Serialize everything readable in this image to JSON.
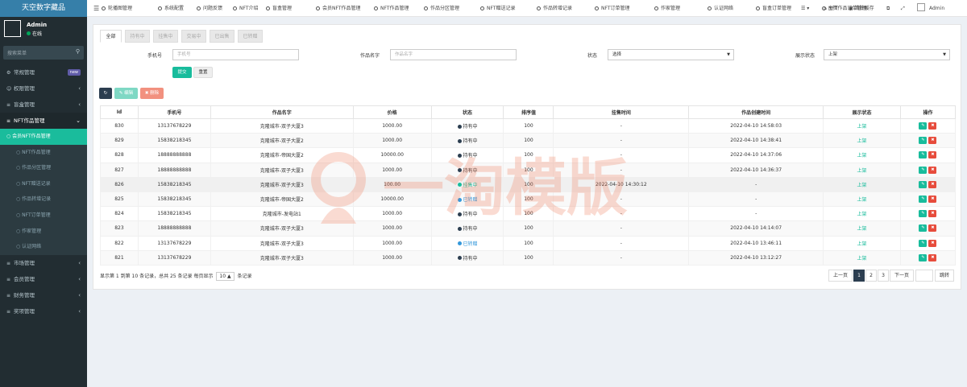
{
  "brand": "天空数字藏品",
  "user": {
    "name": "Admin",
    "status": "在线"
  },
  "sidebar": {
    "search_placeholder": "搜索菜单",
    "new_badge": "new",
    "items_top": [
      {
        "label": "常规管理",
        "icon": "gear-icon",
        "badge": "new"
      },
      {
        "label": "权限管理",
        "icon": "group-icon"
      },
      {
        "label": "盲盒管理",
        "icon": "list-icon"
      }
    ],
    "group": {
      "label": "NFT作品管理",
      "icon": "list-icon"
    },
    "sub_items": [
      "会员NFT作品管理",
      "NFT作品管理",
      "作品分区管理",
      "NFT赠送记录",
      "作品转增记录",
      "NFT订单管理",
      "作家管理",
      "认证网络"
    ],
    "items_bottom": [
      {
        "label": "市场管理",
        "icon": "list-icon"
      },
      {
        "label": "会员管理",
        "icon": "list-icon"
      },
      {
        "label": "财务管理",
        "icon": "list-icon"
      },
      {
        "label": "奖项管理",
        "icon": "list-icon"
      }
    ]
  },
  "topnav": {
    "tabs": [
      "轮播图管理",
      "系统配置",
      "问题反馈",
      "NFT介绍",
      "盲盒管理",
      "会员NFT作品管理",
      "NFT作品管理",
      "作品分区管理",
      "NFT赠送记录",
      "作品转增记录",
      "NFT订单管理",
      "作家管理",
      "认证网络",
      "盲盒订单管理",
      "NFT作品订单管理"
    ],
    "home": "主页",
    "clear_cache": "清除缓存",
    "admin": "Admin"
  },
  "status_tabs": [
    "全部",
    "持有中",
    "挂售中",
    "交易中",
    "已出售",
    "已转赠"
  ],
  "filters": {
    "phone_label": "手机号",
    "phone_placeholder": "手机号",
    "name_label": "作品名字",
    "name_placeholder": "作品名字",
    "status_label": "状态",
    "status_value": "选择",
    "show_label": "展示状态",
    "show_value": "上架",
    "submit": "提交",
    "reset": "重置"
  },
  "toolbar": {
    "edit": "编辑",
    "delete": "删除"
  },
  "table": {
    "headers": [
      "Id",
      "手机号",
      "作品名字",
      "价格",
      "状态",
      "排序值",
      "挂售时间",
      "作品创建时间",
      "展示状态",
      "操作"
    ],
    "rows": [
      {
        "id": "830",
        "phone": "13137678229",
        "name": "克隆城市-双子大厦3",
        "price": "1000.00",
        "status": "持有中",
        "status_color": "#2c3e50",
        "sort": "100",
        "sale_time": "-",
        "created": "2022-04-10 14:58:03",
        "show": "上架"
      },
      {
        "id": "829",
        "phone": "15838218345",
        "name": "克隆城市-双子大厦2",
        "price": "1000.00",
        "status": "持有中",
        "status_color": "#2c3e50",
        "sort": "100",
        "sale_time": "-",
        "created": "2022-04-10 14:38:41",
        "show": "上架"
      },
      {
        "id": "828",
        "phone": "18888888888",
        "name": "克隆城市-帝国大厦2",
        "price": "10000.00",
        "status": "持有中",
        "status_color": "#2c3e50",
        "sort": "100",
        "sale_time": "-",
        "created": "2022-04-10 14:37:06",
        "show": "上架"
      },
      {
        "id": "827",
        "phone": "18888888888",
        "name": "克隆城市-双子大厦3",
        "price": "1000.00",
        "status": "持有中",
        "status_color": "#2c3e50",
        "sort": "100",
        "sale_time": "-",
        "created": "2022-04-10 14:36:37",
        "show": "上架"
      },
      {
        "id": "826",
        "phone": "15838218345",
        "name": "克隆城市-双子大厦3",
        "price": "100.00",
        "status": "挂售中",
        "status_color": "#18bc9c",
        "sort": "100",
        "sale_time": "2022-04-10 14:30:12",
        "created": "-",
        "show": "上架"
      },
      {
        "id": "825",
        "phone": "15838218345",
        "name": "克隆城市-帝国大厦2",
        "price": "10000.00",
        "status": "已转赠",
        "status_color": "#3498db",
        "sort": "100",
        "sale_time": "-",
        "created": "-",
        "show": "上架"
      },
      {
        "id": "824",
        "phone": "15838218345",
        "name": "克隆城市-发电站1",
        "price": "1000.00",
        "status": "持有中",
        "status_color": "#2c3e50",
        "sort": "100",
        "sale_time": "-",
        "created": "-",
        "show": "上架"
      },
      {
        "id": "823",
        "phone": "18888888888",
        "name": "克隆城市-双子大厦3",
        "price": "1000.00",
        "status": "持有中",
        "status_color": "#2c3e50",
        "sort": "100",
        "sale_time": "-",
        "created": "2022-04-10 14:14:07",
        "show": "上架"
      },
      {
        "id": "822",
        "phone": "13137678229",
        "name": "克隆城市-双子大厦3",
        "price": "1000.00",
        "status": "已转赠",
        "status_color": "#3498db",
        "sort": "100",
        "sale_time": "-",
        "created": "2022-04-10 13:46:11",
        "show": "上架"
      },
      {
        "id": "821",
        "phone": "13137678229",
        "name": "克隆城市-双子大厦3",
        "price": "1000.00",
        "status": "持有中",
        "status_color": "#2c3e50",
        "sort": "100",
        "sale_time": "-",
        "created": "2022-04-10 13:12:27",
        "show": "上架"
      }
    ]
  },
  "footer": {
    "summary": "显示第 1 到第 10 条记录，总共 25 条记录 每页显示",
    "page_size": "10",
    "suffix": "条记录"
  },
  "pagination": {
    "prev": "上一页",
    "pages": [
      "1",
      "2",
      "3"
    ],
    "next": "下一页",
    "jump": "跳转",
    "current": "1"
  },
  "watermark": "一淘模版",
  "colors": {
    "accent": "#1abc9c",
    "sidebar_bg": "#222d32",
    "logo_bg": "#367fa9",
    "dark_btn": "#2c3e50"
  }
}
